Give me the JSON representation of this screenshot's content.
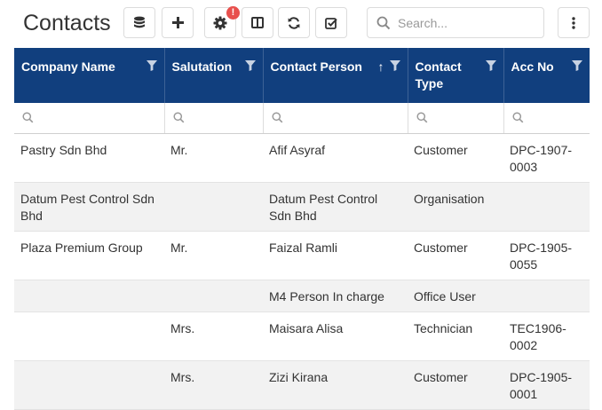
{
  "page": {
    "title": "Contacts"
  },
  "toolbar": {
    "buttons": [
      {
        "name": "database-icon"
      },
      {
        "name": "plus-icon"
      },
      {
        "name": "gear-icon",
        "badge": "!"
      },
      {
        "name": "columns-icon"
      },
      {
        "name": "refresh-icon"
      },
      {
        "name": "check-square-icon"
      }
    ],
    "more": {
      "icon": "vertical-ellipsis-icon"
    }
  },
  "search": {
    "placeholder": "Search...",
    "value": ""
  },
  "colors": {
    "header_bg": "#113f7e",
    "alt_row": "#f2f2f2",
    "badge": "#e8504d"
  },
  "table": {
    "columns": [
      {
        "label": "Company Name"
      },
      {
        "label": "Salutation"
      },
      {
        "label": "Contact Person",
        "sort": "↑"
      },
      {
        "label": "Contact Type"
      },
      {
        "label": "Acc No"
      }
    ],
    "rows": [
      [
        "Pastry Sdn Bhd",
        "Mr.",
        "Afif Asyraf",
        "Customer",
        "DPC-1907-0003"
      ],
      [
        "Datum Pest Control Sdn Bhd",
        "",
        "Datum Pest Control Sdn Bhd",
        "Organisation",
        ""
      ],
      [
        "Plaza Premium Group",
        "Mr.",
        "Faizal Ramli",
        "Customer",
        "DPC-1905-0055"
      ],
      [
        "",
        "",
        "M4 Person In charge",
        "Office User",
        ""
      ],
      [
        "",
        "Mrs.",
        "Maisara Alisa",
        "Technician",
        "TEC1906-0002"
      ],
      [
        "",
        "Mrs.",
        "Zizi Kirana",
        "Customer",
        "DPC-1905-0001"
      ]
    ]
  }
}
